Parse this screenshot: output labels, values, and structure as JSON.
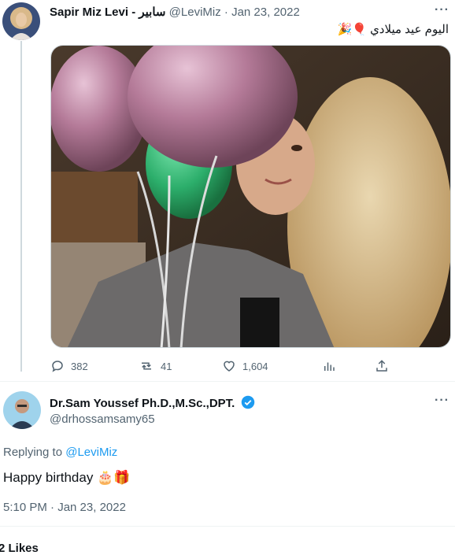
{
  "original_tweet": {
    "display_name": "Sapir Miz Levi - سابير",
    "handle": "@LeviMiz",
    "separator": "·",
    "date": "Jan 23, 2022",
    "text": "اليوم عيد ميلادي 🎈🎉",
    "more_icon": "more-horizontal-icon",
    "stats": {
      "replies": "382",
      "retweets": "41",
      "likes": "1,604"
    }
  },
  "reply_tweet": {
    "display_name": "Dr.Sam Youssef Ph.D.,M.Sc.,DPT.",
    "handle": "@drhossamsamy65",
    "replying_prefix": "Replying to",
    "replying_to": "@LeviMiz",
    "text": "Happy birthday 🎂🎁",
    "timestamp": "5:10 PM · Jan 23, 2022",
    "more_icon": "more-horizontal-icon"
  },
  "footer": {
    "likes_text": "2 Likes"
  },
  "colors": {
    "accent": "#1d9bf0",
    "muted": "#536471",
    "border": "#cfd9de"
  }
}
